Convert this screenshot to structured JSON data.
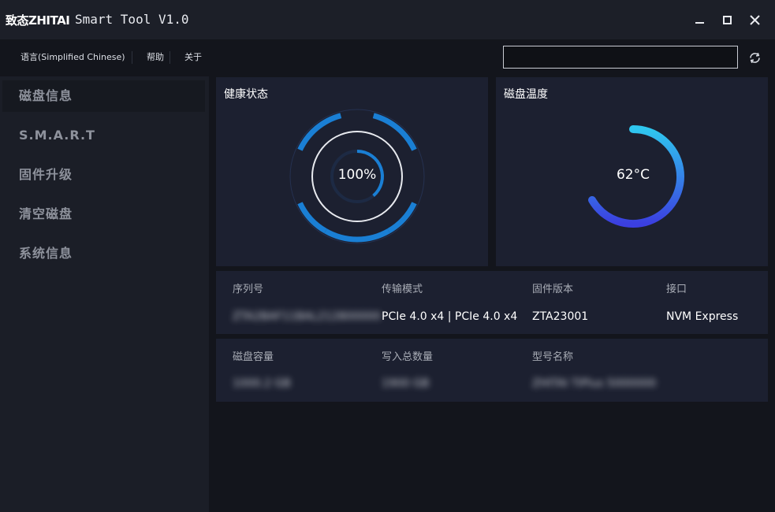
{
  "window": {
    "logo_text": "致态ZHITAI",
    "title": "Smart Tool V1.0"
  },
  "menu": {
    "items": [
      "语言(Simplified Chinese)",
      "帮助",
      "关于"
    ],
    "search": {
      "value": "",
      "placeholder": ""
    }
  },
  "sidebar": {
    "items": [
      {
        "label": "磁盘信息",
        "active": true
      },
      {
        "label": "S.M.A.R.T",
        "active": false
      },
      {
        "label": "固件升级",
        "active": false
      },
      {
        "label": "清空磁盘",
        "active": false
      },
      {
        "label": "系统信息",
        "active": false
      }
    ]
  },
  "health": {
    "title": "健康状态",
    "percent": 100,
    "value_text": "100%",
    "accent_color": "#1a7fd4"
  },
  "temperature": {
    "title": "磁盘温度",
    "celsius": 62,
    "value_text": "62°C",
    "gradient_start": "#2fc7ef",
    "gradient_end": "#3b3fe0"
  },
  "info_row1": {
    "serial": {
      "label": "序列号",
      "value": "ZTA2BAF11BAL212800000"
    },
    "transfer": {
      "label": "传输模式",
      "value": "PCIe 4.0 x4 | PCIe 4.0 x4"
    },
    "firmware": {
      "label": "固件版本",
      "value": "ZTA23001"
    },
    "interface": {
      "label": "接口",
      "value": "NVM Express"
    }
  },
  "info_row2": {
    "capacity": {
      "label": "磁盘容量",
      "value": "1000.2 GB"
    },
    "total_written": {
      "label": "写入总数量",
      "value": "1900 GB"
    },
    "model": {
      "label": "型号名称",
      "value": "ZHITAI TiPlus 5000000"
    }
  },
  "colors": {
    "background": "#13151c",
    "sidebar": "#1b1e27",
    "panel": "#1c2030"
  }
}
